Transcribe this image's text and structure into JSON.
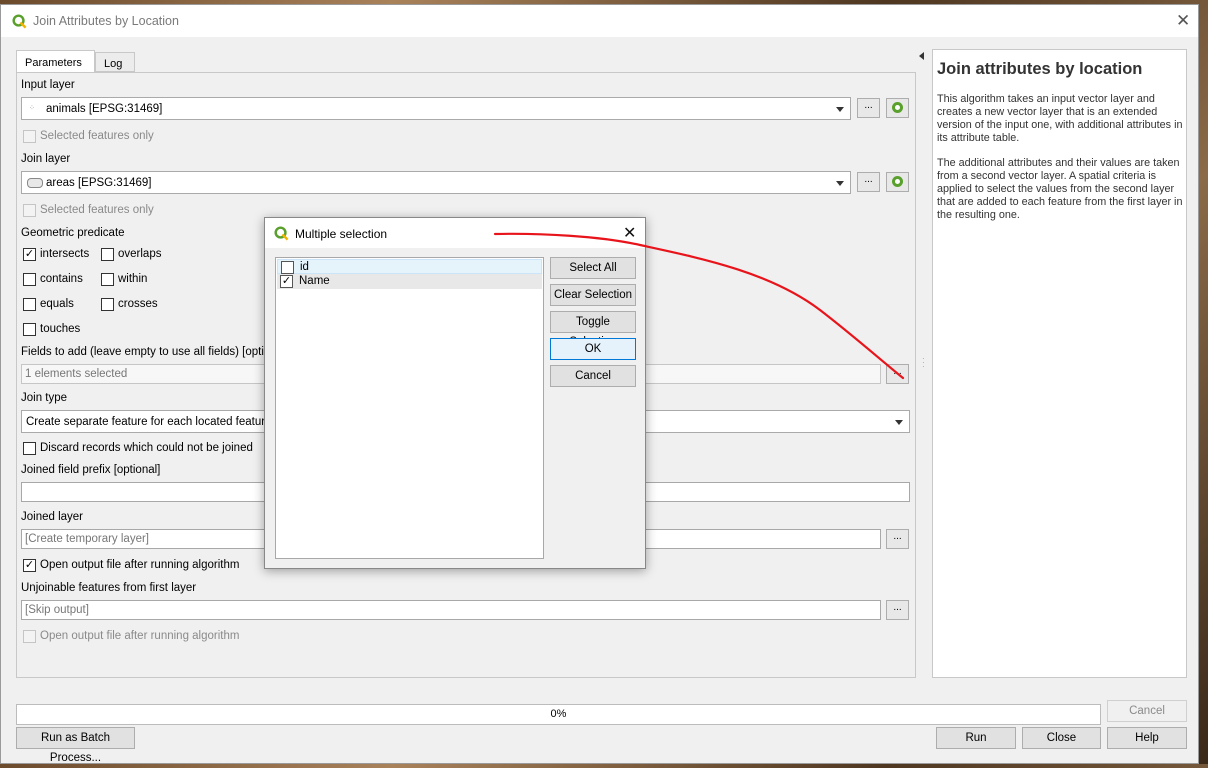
{
  "window": {
    "title": "Join Attributes by Location"
  },
  "tabs": [
    "Parameters",
    "Log"
  ],
  "params": {
    "input_layer": {
      "label": "Input layer",
      "value": "animals [EPSG:31469]",
      "selected_only": "Selected features only"
    },
    "join_layer": {
      "label": "Join layer",
      "value": "areas [EPSG:31469]",
      "selected_only": "Selected features only"
    },
    "predicate": {
      "label": "Geometric predicate",
      "options": [
        {
          "label": "intersects",
          "checked": true
        },
        {
          "label": "overlaps",
          "checked": false
        },
        {
          "label": "contains",
          "checked": false
        },
        {
          "label": "within",
          "checked": false
        },
        {
          "label": "equals",
          "checked": false
        },
        {
          "label": "crosses",
          "checked": false
        },
        {
          "label": "touches",
          "checked": false
        }
      ]
    },
    "fields": {
      "label": "Fields to add (leave empty to use all fields) [optional]",
      "value": "1 elements selected"
    },
    "join_type": {
      "label": "Join type",
      "value": "Create separate feature for each located feature (one-to-many)"
    },
    "discard": "Discard records which could not be joined",
    "prefix": {
      "label": "Joined field prefix [optional]"
    },
    "joined_layer": {
      "label": "Joined layer",
      "placeholder": "[Create temporary layer]",
      "open_after": "Open output file after running algorithm"
    },
    "unjoinable": {
      "label": "Unjoinable features from first layer",
      "placeholder": "[Skip output]",
      "open_after": "Open output file after running algorithm"
    }
  },
  "help": {
    "title": "Join attributes by location",
    "p1": "This algorithm takes an input vector layer and creates a new vector layer that is an extended version of the input one, with additional attributes in its attribute table.",
    "p2": "The additional attributes and their values are taken from a second vector layer. A spatial criteria is applied to select the values from the second layer that are added to each feature from the first layer in the resulting one."
  },
  "progress": "0%",
  "buttons": {
    "dots": "...",
    "cancel": "Cancel",
    "batch": "Run as Batch Process...",
    "run": "Run",
    "close": "Close",
    "help": "Help"
  },
  "dialog": {
    "title": "Multiple selection",
    "items": [
      {
        "label": "id",
        "checked": false
      },
      {
        "label": "Name",
        "checked": true
      }
    ],
    "buttons": {
      "select_all": "Select All",
      "clear": "Clear Selection",
      "toggle": "Toggle Selection",
      "ok": "OK",
      "cancel": "Cancel"
    }
  },
  "colors": {
    "annotation": "#e8141b",
    "accent": "#0078d7",
    "qgis_green": "#5aa02c"
  }
}
